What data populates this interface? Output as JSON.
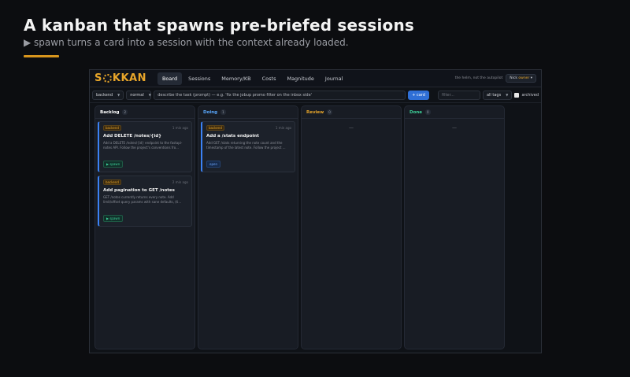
{
  "hero": {
    "title": "A kanban that spawns pre-briefed sessions",
    "subtitle": "▶ spawn turns a card into a session with the context already loaded.",
    "accent_color": "#d8951d"
  },
  "app": {
    "logo": {
      "pre": "S",
      "post": "KKAN"
    },
    "nav": [
      "Board",
      "Sessions",
      "Memory/KB",
      "Costs",
      "Magnitude",
      "Journal"
    ],
    "active_nav": "Board",
    "tagline": "the helm, not the autopilot",
    "user": {
      "name": "Nick",
      "role": "owner",
      "chevron": "▾"
    }
  },
  "toolbar": {
    "project": "backend",
    "priority": "normal",
    "prompt_placeholder": "describe the task (prompt) — e.g. 'fix the jobup promo filter on the inbox side'",
    "add_label": "+ card",
    "filter_placeholder": "filter...",
    "tags_select": "all tags",
    "archived_label": "archived"
  },
  "board": {
    "columns": [
      {
        "title": "Backlog",
        "count": "2",
        "color": "#ffffff",
        "cards": [
          {
            "tag": "backend",
            "ago": "1 min ago",
            "title": "Add DELETE /notes/{id}",
            "desc": "Add a DELETE /notes/{id} endpoint to the fastapi-notes API. Follow the project's conventions fro...",
            "action": "▶ spawn",
            "action_type": "spawn"
          },
          {
            "tag": "backend",
            "ago": "2 min ago",
            "title": "Add pagination to GET /notes",
            "desc": "GET /notes currently returns every note. Add limit/offset query params with sane defaults, (ti...",
            "action": "▶ spawn",
            "action_type": "spawn"
          }
        ]
      },
      {
        "title": "Doing",
        "count": "1",
        "color": "#5aa9ff",
        "cards": [
          {
            "tag": "backend",
            "ago": "1 min ago",
            "title": "Add a /stats endpoint",
            "desc": "Add GET /stats returning the note count and the timestamp of the latest note. Follow the project ...",
            "action": "open",
            "action_type": "open"
          }
        ]
      },
      {
        "title": "Review",
        "count": "0",
        "color": "#e8a62a",
        "empty": "—",
        "cards": []
      },
      {
        "title": "Done",
        "count": "0",
        "color": "#3ed29a",
        "empty": "—",
        "cards": []
      }
    ]
  }
}
